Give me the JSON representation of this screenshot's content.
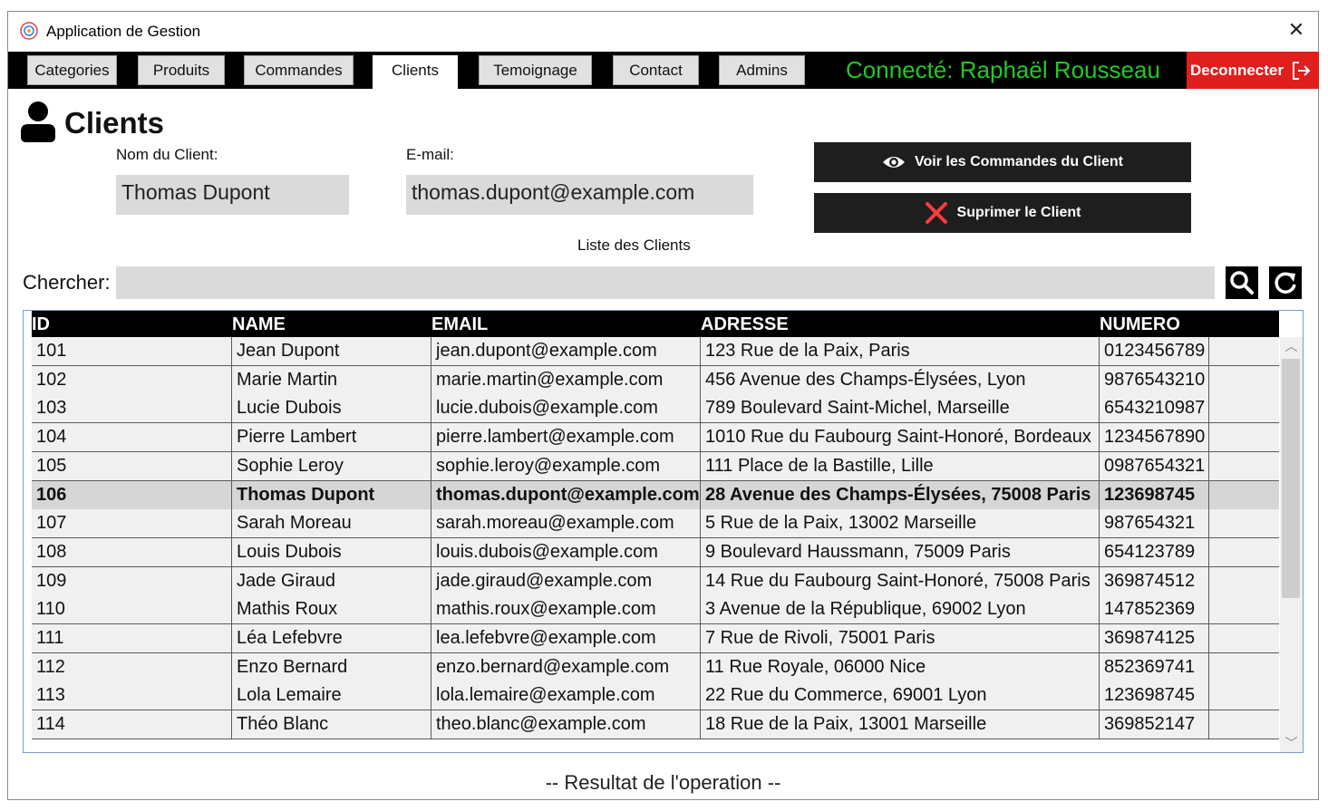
{
  "window": {
    "title": "Application de Gestion",
    "close": "✕"
  },
  "nav": {
    "tabs": [
      {
        "label": "Categories"
      },
      {
        "label": "Produits"
      },
      {
        "label": "Commandes"
      },
      {
        "label": "Clients"
      },
      {
        "label": "Temoignage"
      },
      {
        "label": "Contact"
      },
      {
        "label": "Admins"
      }
    ],
    "active_tab": "Clients",
    "connected_text": "Connecté: Raphaël Rousseau",
    "logout_label": "Deconnecter"
  },
  "page": {
    "title": "Clients"
  },
  "form": {
    "name_label": "Nom du Client:",
    "name_value": "Thomas Dupont",
    "email_label": "E-mail:",
    "email_value": "thomas.dupont@example.com",
    "view_orders_label": "Voir les Commandes du Client",
    "delete_label": "Suprimer le Client"
  },
  "list": {
    "caption": "Liste des Clients",
    "search_label": "Chercher:",
    "search_value": "",
    "columns": [
      "ID",
      "NAME",
      "EMAIL",
      "ADRESSE",
      "NUMERO"
    ],
    "selected_id": "106",
    "rows": [
      [
        "101",
        "Jean Dupont",
        "jean.dupont@example.com",
        "123 Rue de la Paix, Paris",
        "0123456789"
      ],
      [
        "102",
        "Marie Martin",
        "marie.martin@example.com",
        "456 Avenue des Champs-Élysées, Lyon",
        "9876543210"
      ],
      [
        "103",
        "Lucie Dubois",
        "lucie.dubois@example.com",
        "789 Boulevard Saint-Michel, Marseille",
        "6543210987"
      ],
      [
        "104",
        "Pierre Lambert",
        "pierre.lambert@example.com",
        "1010 Rue du Faubourg Saint-Honoré, Bordeaux",
        "1234567890"
      ],
      [
        "105",
        "Sophie Leroy",
        "sophie.leroy@example.com",
        "111 Place de la Bastille, Lille",
        "0987654321"
      ],
      [
        "106",
        "Thomas Dupont",
        "thomas.dupont@example.com",
        "28 Avenue des Champs-Élysées, 75008 Paris",
        "123698745"
      ],
      [
        "107",
        "Sarah Moreau",
        "sarah.moreau@example.com",
        "5 Rue de la Paix, 13002 Marseille",
        "987654321"
      ],
      [
        "108",
        "Louis Dubois",
        "louis.dubois@example.com",
        "9 Boulevard Haussmann, 75009 Paris",
        "654123789"
      ],
      [
        "109",
        "Jade Giraud",
        "jade.giraud@example.com",
        "14 Rue du Faubourg Saint-Honoré, 75008 Paris",
        "369874512"
      ],
      [
        "110",
        "Mathis Roux",
        "mathis.roux@example.com",
        "3 Avenue de la République, 69002 Lyon",
        "147852369"
      ],
      [
        "111",
        "Léa Lefebvre",
        "lea.lefebvre@example.com",
        "7 Rue de Rivoli, 75001 Paris",
        "369874125"
      ],
      [
        "112",
        "Enzo Bernard",
        "enzo.bernard@example.com",
        "11 Rue Royale, 06000 Nice",
        "852369741"
      ],
      [
        "113",
        "Lola Lemaire",
        "lola.lemaire@example.com",
        "22 Rue du Commerce, 69001 Lyon",
        "123698745"
      ],
      [
        "114",
        "Théo Blanc",
        "theo.blanc@example.com",
        "18 Rue de la Paix, 13001 Marseille",
        "369852147"
      ]
    ]
  },
  "status": {
    "text": "-- Resultat de l'operation --"
  },
  "colors": {
    "connected": "#22c922",
    "logout_bg": "#e01e1e",
    "nav_bg": "#000000",
    "button_bg": "#1e1e1e"
  },
  "icons": {
    "app": "app-logo-icon",
    "user": "user-icon",
    "eye": "eye-icon",
    "delete": "x-icon",
    "search": "search-icon",
    "refresh": "refresh-icon",
    "logout": "logout-icon"
  }
}
